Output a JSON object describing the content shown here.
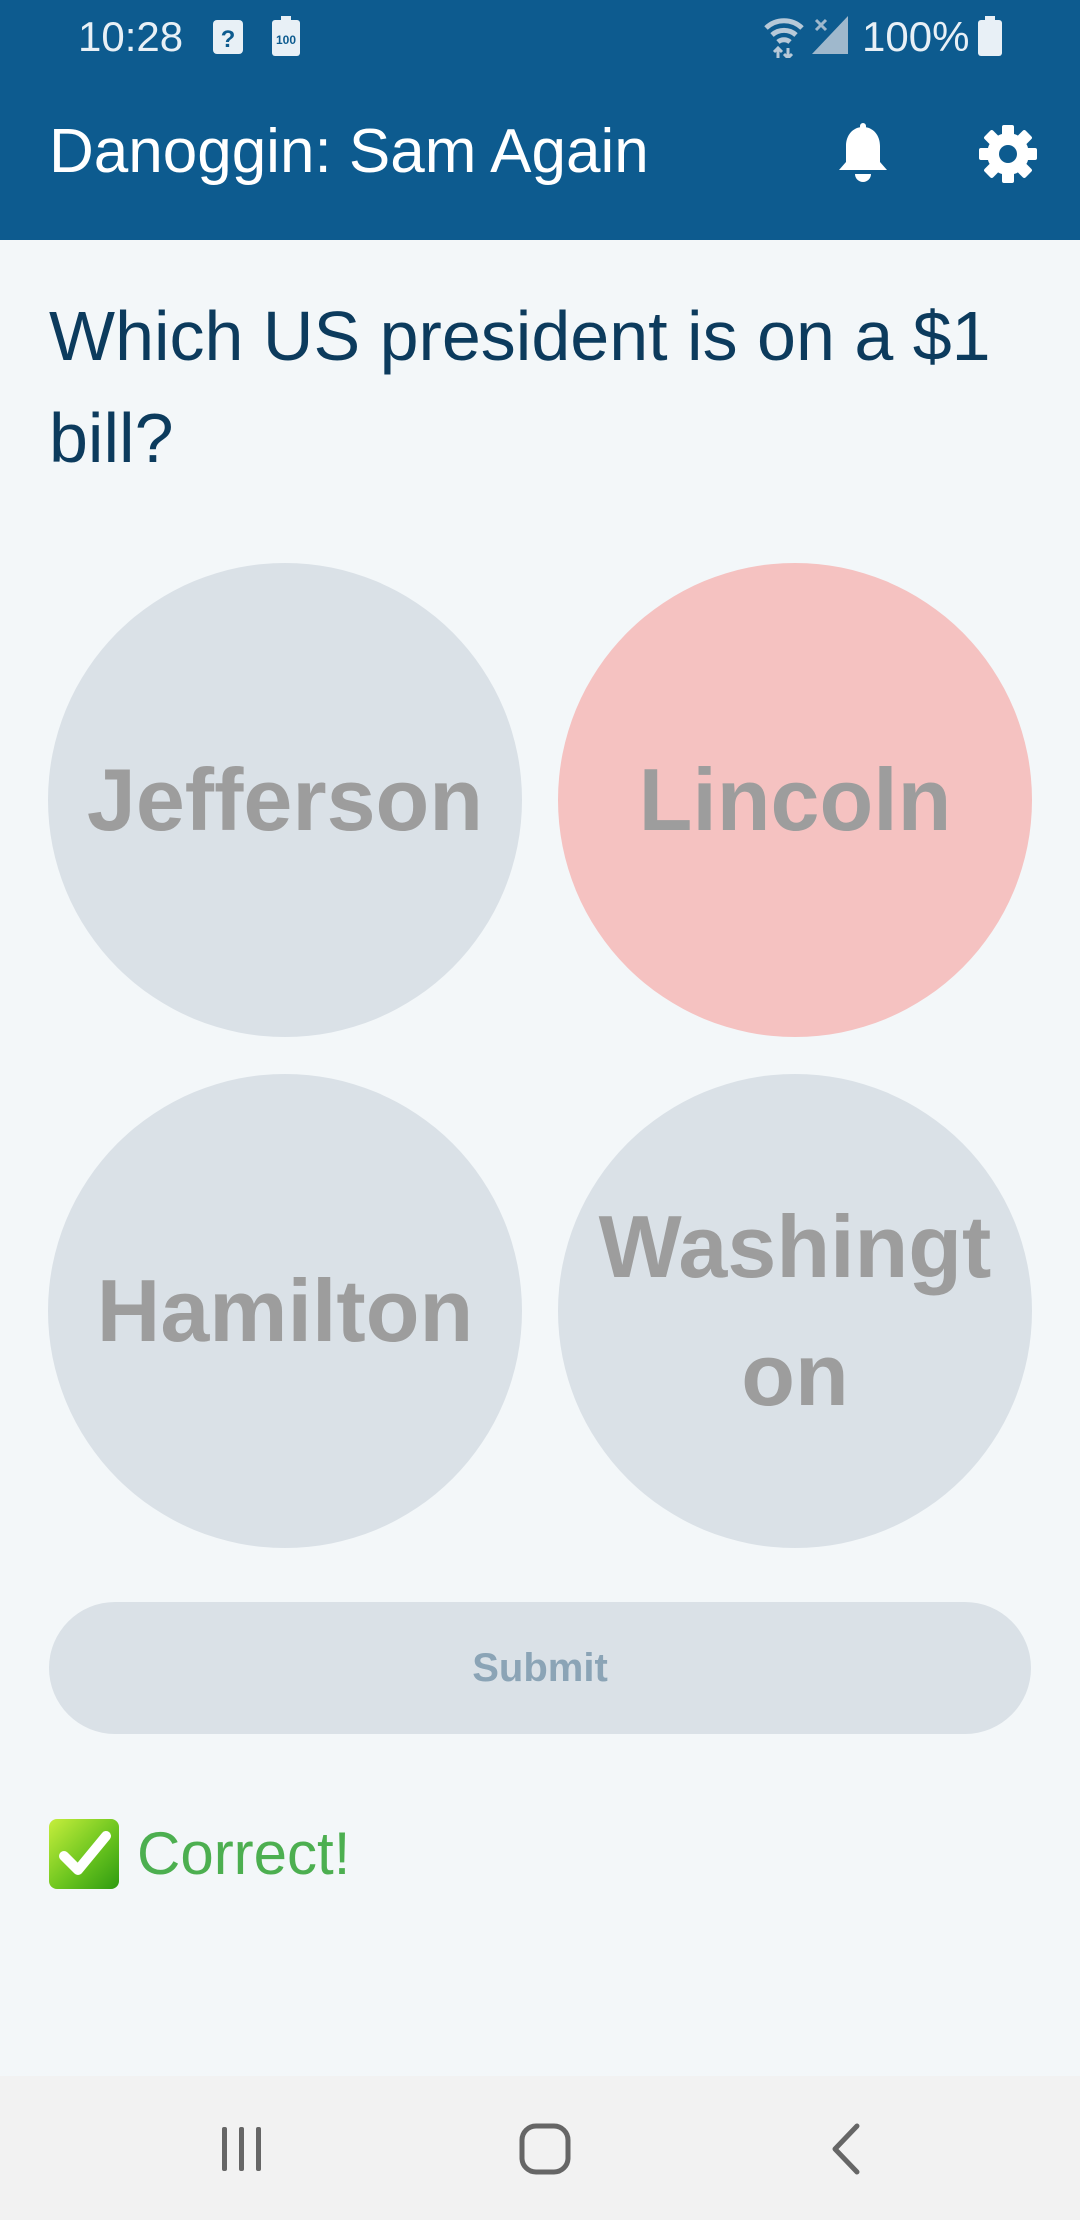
{
  "status_bar": {
    "time": "10:28",
    "battery_percent": "100%",
    "icons": [
      "unknown-notification-icon",
      "battery-saver-icon",
      "wifi-icon",
      "signal-icon",
      "battery-icon"
    ]
  },
  "app_bar": {
    "title": "Danoggin: Sam Again",
    "actions": [
      "bell-icon",
      "gear-icon"
    ]
  },
  "question": {
    "text": "Which US president is on a $1 bill?"
  },
  "choices": [
    {
      "label": "Jefferson",
      "state": "unselected"
    },
    {
      "label": "Lincoln",
      "state": "selected"
    },
    {
      "label": "Hamilton",
      "state": "unselected"
    },
    {
      "label": "Washington",
      "state": "unselected"
    }
  ],
  "submit": {
    "label": "Submit",
    "enabled": false
  },
  "feedback": {
    "icon": "check-mark-icon",
    "text": "Correct!"
  },
  "nav_bar": {
    "buttons": [
      "recent-apps-icon",
      "home-icon",
      "back-icon"
    ]
  },
  "colors": {
    "primary": "#0d5b8f",
    "background": "#f3f7f9",
    "question_text": "#0c3b5d",
    "choice_neutral": "#dae1e7",
    "choice_selected": "#f5c2c1",
    "choice_text": "#9d9d9d",
    "submit_text": "#8ba4b6",
    "feedback_text": "#4caf50"
  }
}
